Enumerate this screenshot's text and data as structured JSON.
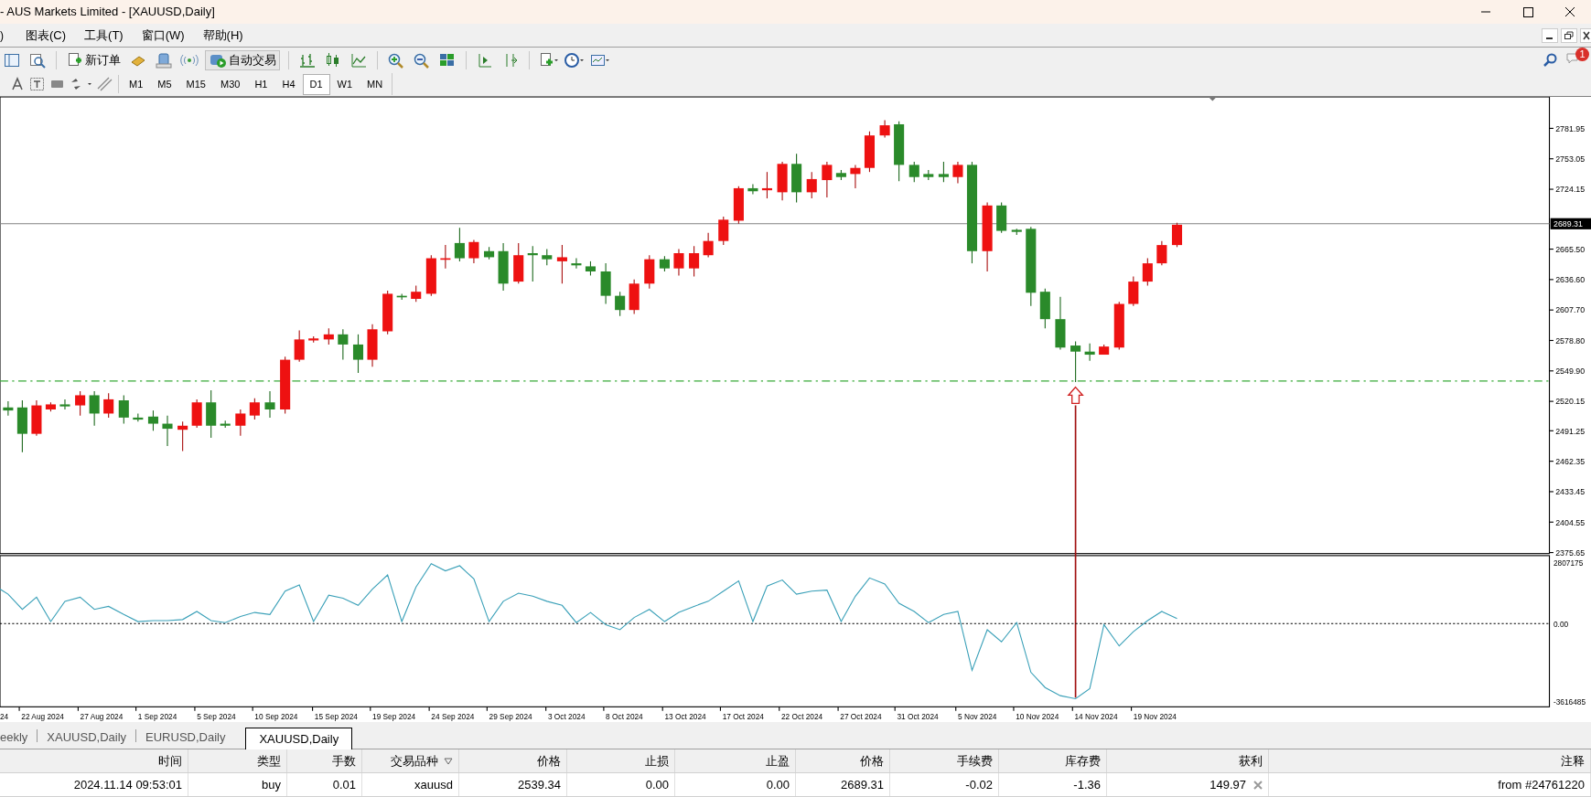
{
  "window": {
    "title": "- AUS Markets Limited - [XAUUSD,Daily]"
  },
  "menu": [
    ")",
    "图表(C)",
    "工具(T)",
    "窗口(W)",
    "帮助(H)"
  ],
  "toolbar": {
    "new_order": "新订单",
    "auto_trading": "自动交易"
  },
  "timeframes": [
    {
      "label": "M1",
      "selected": false
    },
    {
      "label": "M5",
      "selected": false
    },
    {
      "label": "M15",
      "selected": false
    },
    {
      "label": "M30",
      "selected": false
    },
    {
      "label": "H1",
      "selected": false
    },
    {
      "label": "H4",
      "selected": false
    },
    {
      "label": "D1",
      "selected": true
    },
    {
      "label": "W1",
      "selected": false
    },
    {
      "label": "MN",
      "selected": false
    }
  ],
  "notifications": {
    "badge": "1"
  },
  "chart": {
    "price_labels": [
      "2781.95",
      "2753.05",
      "2724.15",
      "2665.50",
      "2636.60",
      "2607.70",
      "2578.80",
      "2549.90",
      "2520.15",
      "2491.25",
      "2462.35",
      "2433.45",
      "2404.55",
      "2375.65"
    ],
    "current_price": "2689.31",
    "indicator_labels": [
      "2807175",
      "0.00",
      "-3616485"
    ],
    "date_labels": [
      "24",
      "22 Aug 2024",
      "27 Aug 2024",
      "1 Sep 2024",
      "5 Sep 2024",
      "10 Sep 2024",
      "15 Sep 2024",
      "19 Sep 2024",
      "24 Sep 2024",
      "29 Sep 2024",
      "3 Oct 2024",
      "8 Oct 2024",
      "13 Oct 2024",
      "17 Oct 2024",
      "22 Oct 2024",
      "27 Oct 2024",
      "31 Oct 2024",
      "5 Nov 2024",
      "10 Nov 2024",
      "14 Nov 2024",
      "19 Nov 2024"
    ]
  },
  "tabs": [
    {
      "label": "eekly",
      "selected": false
    },
    {
      "label": "XAUUSD,Daily",
      "selected": false
    },
    {
      "label": "EURUSD,Daily",
      "selected": false
    },
    {
      "label": "XAUUSD,Daily",
      "selected": true
    }
  ],
  "trade_table": {
    "columns": [
      {
        "label": "时间",
        "sorted": false
      },
      {
        "label": "类型",
        "sorted": false
      },
      {
        "label": "手数",
        "sorted": false
      },
      {
        "label": "交易品种",
        "sorted": true
      },
      {
        "label": "价格",
        "sorted": false
      },
      {
        "label": "止损",
        "sorted": false
      },
      {
        "label": "止盈",
        "sorted": false
      },
      {
        "label": "价格",
        "sorted": false
      },
      {
        "label": "手续费",
        "sorted": false
      },
      {
        "label": "库存费",
        "sorted": false
      },
      {
        "label": "获利",
        "sorted": false
      },
      {
        "label": "注释",
        "sorted": false
      }
    ],
    "rows": [
      {
        "cells": [
          "2024.11.14 09:53:01",
          "buy",
          "0.01",
          "xauusd",
          "2539.34",
          "0.00",
          "0.00",
          "2689.31",
          "-0.02",
          "-1.36",
          "149.97",
          "from #24761220"
        ]
      }
    ]
  }
}
